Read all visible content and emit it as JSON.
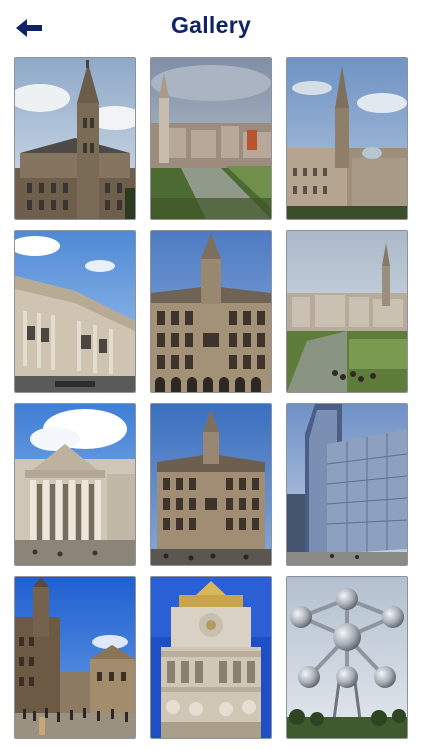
{
  "header": {
    "title": "Gallery",
    "back_icon": "arrow-left-icon"
  },
  "colors": {
    "title": "#0f2466",
    "tile_border": "#8f9299"
  },
  "gallery": {
    "photos": [
      {
        "subject": "town-hall-tower"
      },
      {
        "subject": "mont-des-arts-garden"
      },
      {
        "subject": "city-hall-spire-view"
      },
      {
        "subject": "classical-building-corner"
      },
      {
        "subject": "maison-du-roi-facade"
      },
      {
        "subject": "mont-des-arts-terrace"
      },
      {
        "subject": "bourse-facade"
      },
      {
        "subject": "maison-du-roi-wide"
      },
      {
        "subject": "european-parliament"
      },
      {
        "subject": "grand-place-crowd"
      },
      {
        "subject": "guildhall-gable-detail"
      },
      {
        "subject": "atomium"
      }
    ]
  }
}
